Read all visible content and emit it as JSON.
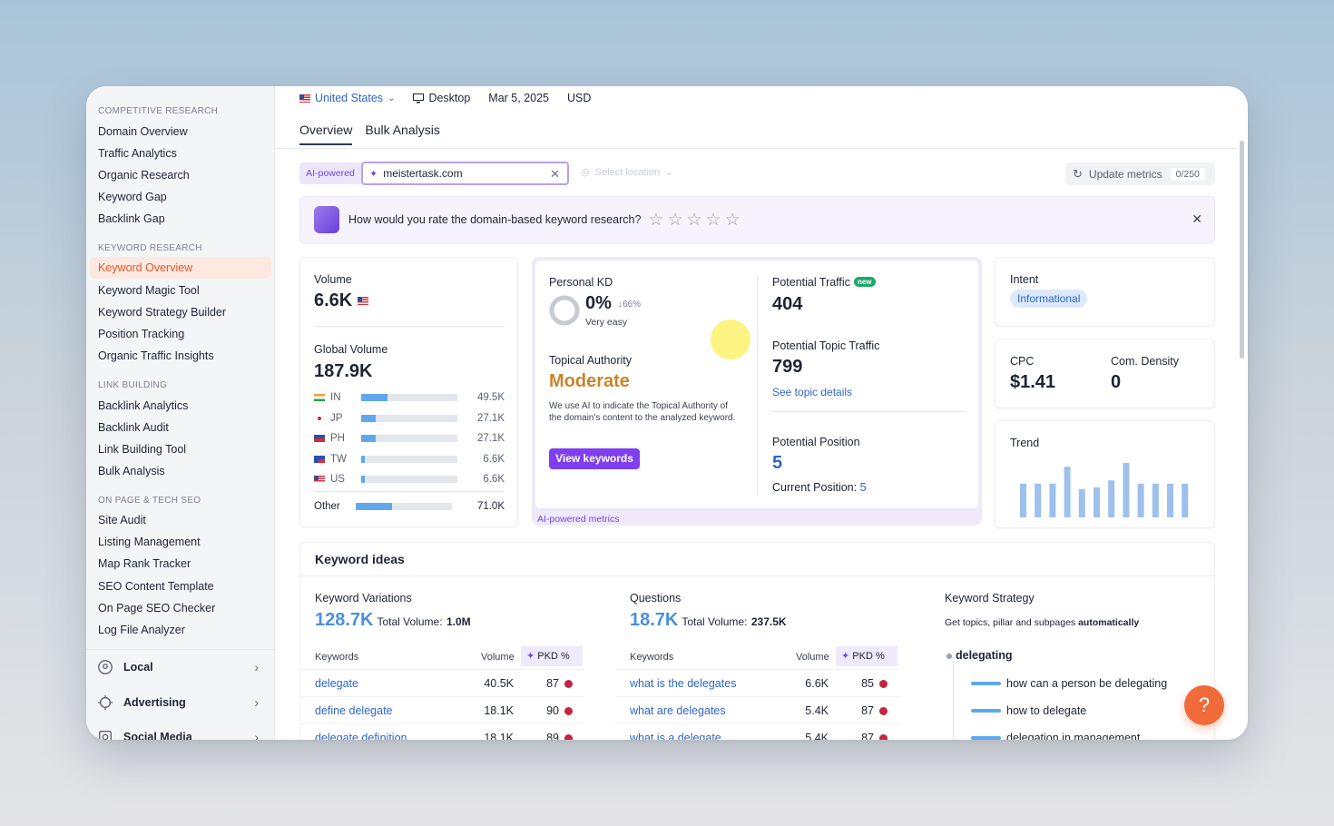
{
  "sidebar": {
    "sections": [
      {
        "title": "COMPETITIVE RESEARCH",
        "items": [
          "Domain Overview",
          "Traffic Analytics",
          "Organic Research",
          "Keyword Gap",
          "Backlink Gap"
        ]
      },
      {
        "title": "KEYWORD RESEARCH",
        "items": [
          "Keyword Overview",
          "Keyword Magic Tool",
          "Keyword Strategy Builder",
          "Position Tracking",
          "Organic Traffic Insights"
        ]
      },
      {
        "title": "LINK BUILDING",
        "items": [
          "Backlink Analytics",
          "Backlink Audit",
          "Link Building Tool",
          "Bulk Analysis"
        ]
      },
      {
        "title": "ON PAGE & TECH SEO",
        "items": [
          "Site Audit",
          "Listing Management",
          "Map Rank Tracker",
          "SEO Content Template",
          "On Page SEO Checker",
          "Log File Analyzer"
        ]
      }
    ],
    "active_item": "Keyword Overview",
    "groups": [
      "Local",
      "Advertising",
      "Social Media"
    ]
  },
  "topbar": {
    "country": "United States",
    "device": "Desktop",
    "date": "Mar 5, 2025",
    "currency": "USD"
  },
  "tabs": [
    "Overview",
    "Bulk Analysis"
  ],
  "search": {
    "ai_label": "AI-powered",
    "value": "meistertask.com",
    "location_placeholder": "Select location"
  },
  "update": {
    "label": "Update metrics",
    "count": "0/250"
  },
  "rating": {
    "question": "How would you rate the domain-based keyword research?",
    "stars": 5
  },
  "volume": {
    "label": "Volume",
    "value": "6.6K",
    "global_label": "Global Volume",
    "global_value": "187.9K",
    "countries": [
      {
        "code": "IN",
        "value": "49.5K",
        "share": 0.27
      },
      {
        "code": "JP",
        "value": "27.1K",
        "share": 0.15
      },
      {
        "code": "PH",
        "value": "27.1K",
        "share": 0.15
      },
      {
        "code": "TW",
        "value": "6.6K",
        "share": 0.04
      },
      {
        "code": "US",
        "value": "6.6K",
        "share": 0.04
      }
    ],
    "other": {
      "label": "Other",
      "value": "71.0K",
      "share": 0.38
    }
  },
  "kd": {
    "label": "Personal KD",
    "value": "0%",
    "change": "↓66%",
    "difficulty": "Very easy",
    "topical_label": "Topical Authority",
    "topical_value": "Moderate",
    "topical_desc": "We use AI to indicate the Topical Authority of the domain's content to the analyzed keyword.",
    "button": "View keywords",
    "footer": "AI-powered metrics"
  },
  "potential": {
    "traffic_label": "Potential Traffic",
    "new_badge": "new",
    "traffic_value": "404",
    "topic_label": "Potential Topic Traffic",
    "topic_value": "799",
    "topic_link": "See topic details",
    "position_label": "Potential Position",
    "position_value": "5",
    "current_label": "Current Position:",
    "current_value": "5"
  },
  "intent": {
    "label": "Intent",
    "value": "Informational"
  },
  "cpc": {
    "label": "CPC",
    "value": "$1.41",
    "density_label": "Com. Density",
    "density_value": "0"
  },
  "trend": {
    "label": "Trend",
    "values": [
      0.62,
      0.62,
      0.62,
      0.93,
      0.52,
      0.55,
      0.68,
      1.0,
      0.62,
      0.62,
      0.62,
      0.62
    ]
  },
  "keyword_ideas": {
    "title": "Keyword ideas",
    "variations": {
      "label": "Keyword Variations",
      "count": "128.7K",
      "total_label": "Total Volume:",
      "total": "1.0M"
    },
    "questions": {
      "label": "Questions",
      "count": "18.7K",
      "total_label": "Total Volume:",
      "total": "237.5K"
    },
    "strategy": {
      "label": "Keyword Strategy",
      "desc_pre": "Get topics, pillar and subpages",
      "desc_bold": "automatically",
      "root": "delegating",
      "items": [
        "how can a person be delegating",
        "how to delegate",
        "delegation in management"
      ]
    },
    "columns": {
      "kw": "Keywords",
      "vol": "Volume",
      "pkd": "PKD %"
    },
    "variation_rows": [
      {
        "kw": "delegate",
        "vol": "40.5K",
        "pkd": "87"
      },
      {
        "kw": "define delegate",
        "vol": "18.1K",
        "pkd": "90"
      },
      {
        "kw": "delegate definition",
        "vol": "18.1K",
        "pkd": "89"
      }
    ],
    "question_rows": [
      {
        "kw": "what is the delegates",
        "vol": "6.6K",
        "pkd": "85"
      },
      {
        "kw": "what are delegates",
        "vol": "5.4K",
        "pkd": "87"
      },
      {
        "kw": "what is a delegate",
        "vol": "5.4K",
        "pkd": "87"
      }
    ]
  },
  "help": {
    "label": "?"
  },
  "colors": {
    "accent": "#7f3ff0",
    "brand_orange": "#f06a3a",
    "link": "#2f66c9",
    "moderate": "#c9842b",
    "bar": "#5fa8ee"
  }
}
